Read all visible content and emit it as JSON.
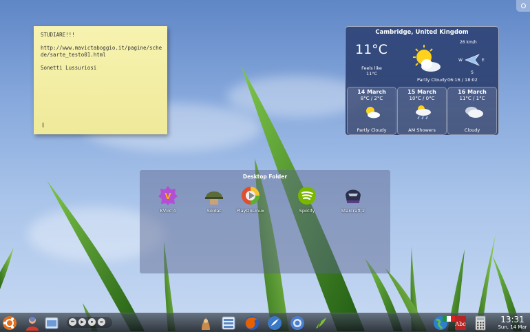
{
  "note": {
    "lines": [
      "STUDIARE!!!",
      "",
      "http://www.mavictaboggio.it/pagine/schede/sarte_testo01.html",
      "",
      "Sonetti Lussuriosi"
    ],
    "cursor": "I"
  },
  "weather": {
    "city": "Cambridge, United Kingdom",
    "temperature": "11°C",
    "feels_label": "Feels like",
    "feels_value": "11°C",
    "condition": "Partly Cloudy",
    "wind_speed": "26 km/h",
    "wind_w": "W",
    "wind_e": "E",
    "wind_s": "S",
    "sunrise_sunset": "06:16 / 18:02",
    "forecast": [
      {
        "day": "14 March",
        "temps": "8°C / 2°C",
        "condition": "Partly Cloudy",
        "icon": "partly-cloudy-icon"
      },
      {
        "day": "15 March",
        "temps": "10°C / 0°C",
        "condition": "AM Showers",
        "icon": "showers-icon"
      },
      {
        "day": "16 March",
        "temps": "11°C / 1°C",
        "condition": "Cloudy",
        "icon": "cloudy-icon"
      }
    ]
  },
  "folder": {
    "title": "Desktop Folder",
    "items": [
      {
        "label": "KVIrc 4",
        "icon": "kvirc-icon"
      },
      {
        "label": "Soldat",
        "icon": "soldat-icon"
      },
      {
        "label": "PlayOnLinux",
        "icon": "playonlinux-icon"
      },
      {
        "label": "Spotify",
        "icon": "spotify-icon"
      },
      {
        "label": "Starcraft 2",
        "icon": "starcraft-icon"
      }
    ]
  },
  "taskbar": {
    "clock_time": "13:31",
    "clock_date": "Sun, 14 Mar",
    "media": [
      "⏮",
      "▶",
      "⏹",
      "⏭"
    ]
  },
  "colors": {
    "sky_top": "#5f86c6",
    "note_bg": "#f7f3b0",
    "spotify_green": "#7ab800",
    "firefox_orange": "#e66000"
  }
}
